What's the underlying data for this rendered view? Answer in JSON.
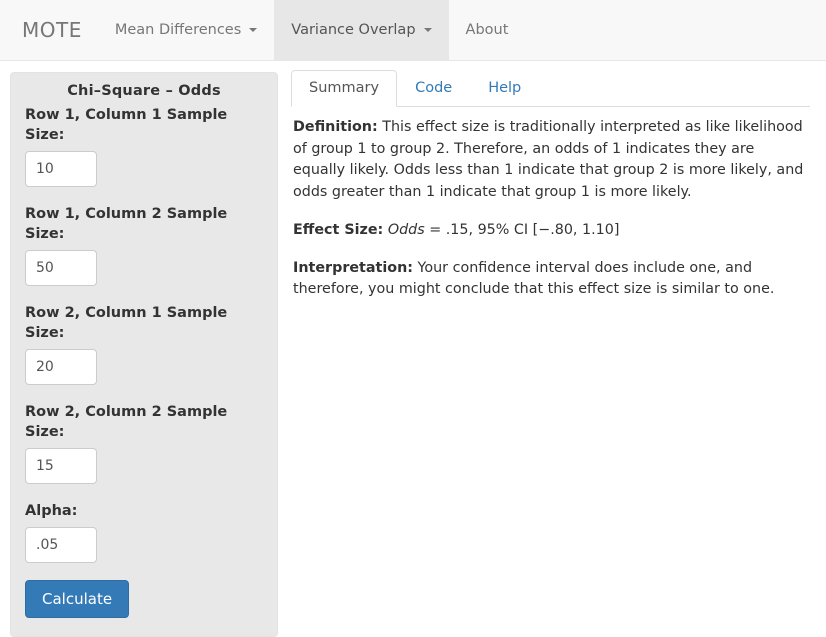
{
  "navbar": {
    "brand": "MOTE",
    "items": [
      {
        "label": "Mean Differences",
        "has_caret": true,
        "active": false
      },
      {
        "label": "Variance Overlap",
        "has_caret": true,
        "active": true
      },
      {
        "label": "About",
        "has_caret": false,
        "active": false
      }
    ]
  },
  "sidebar": {
    "title": "Chi–Square – Odds",
    "fields": [
      {
        "label": "Row 1, Column 1 Sample Size:",
        "value": "10",
        "name": "row1-col1-sample-size"
      },
      {
        "label": "Row 1, Column 2 Sample Size:",
        "value": "50",
        "name": "row1-col2-sample-size"
      },
      {
        "label": "Row 2, Column 1 Sample Size:",
        "value": "20",
        "name": "row2-col1-sample-size"
      },
      {
        "label": "Row 2, Column 2 Sample Size:",
        "value": "15",
        "name": "row2-col2-sample-size"
      },
      {
        "label": "Alpha:",
        "value": ".05",
        "name": "alpha"
      }
    ],
    "calculate_label": "Calculate"
  },
  "main": {
    "tabs": [
      {
        "label": "Summary",
        "active": true
      },
      {
        "label": "Code",
        "active": false
      },
      {
        "label": "Help",
        "active": false
      }
    ],
    "summary": {
      "definition_label": "Definition:",
      "definition_text": " This effect size is traditionally interpreted as like likelihood of group 1 to group 2. Therefore, an odds of 1 indicates they are equally likely. Odds less than 1 indicate that group 2 is more likely, and odds greater than 1 indicate that group 1 is more likely.",
      "effect_size_label": "Effect Size:",
      "effect_size_symbol": "Odds",
      "effect_size_value": " = .15, 95% CI [−.80, 1.10]",
      "interpretation_label": "Interpretation:",
      "interpretation_text": " Your confidence interval does include one, and therefore, you might conclude that this effect size is similar to one."
    }
  },
  "colors": {
    "primary": "#337ab7",
    "navbar_bg": "#f8f8f8",
    "navbar_active_bg": "#e7e7e7",
    "sidebar_bg": "#e8e8e8",
    "link": "#337ab7",
    "text": "#333333"
  }
}
